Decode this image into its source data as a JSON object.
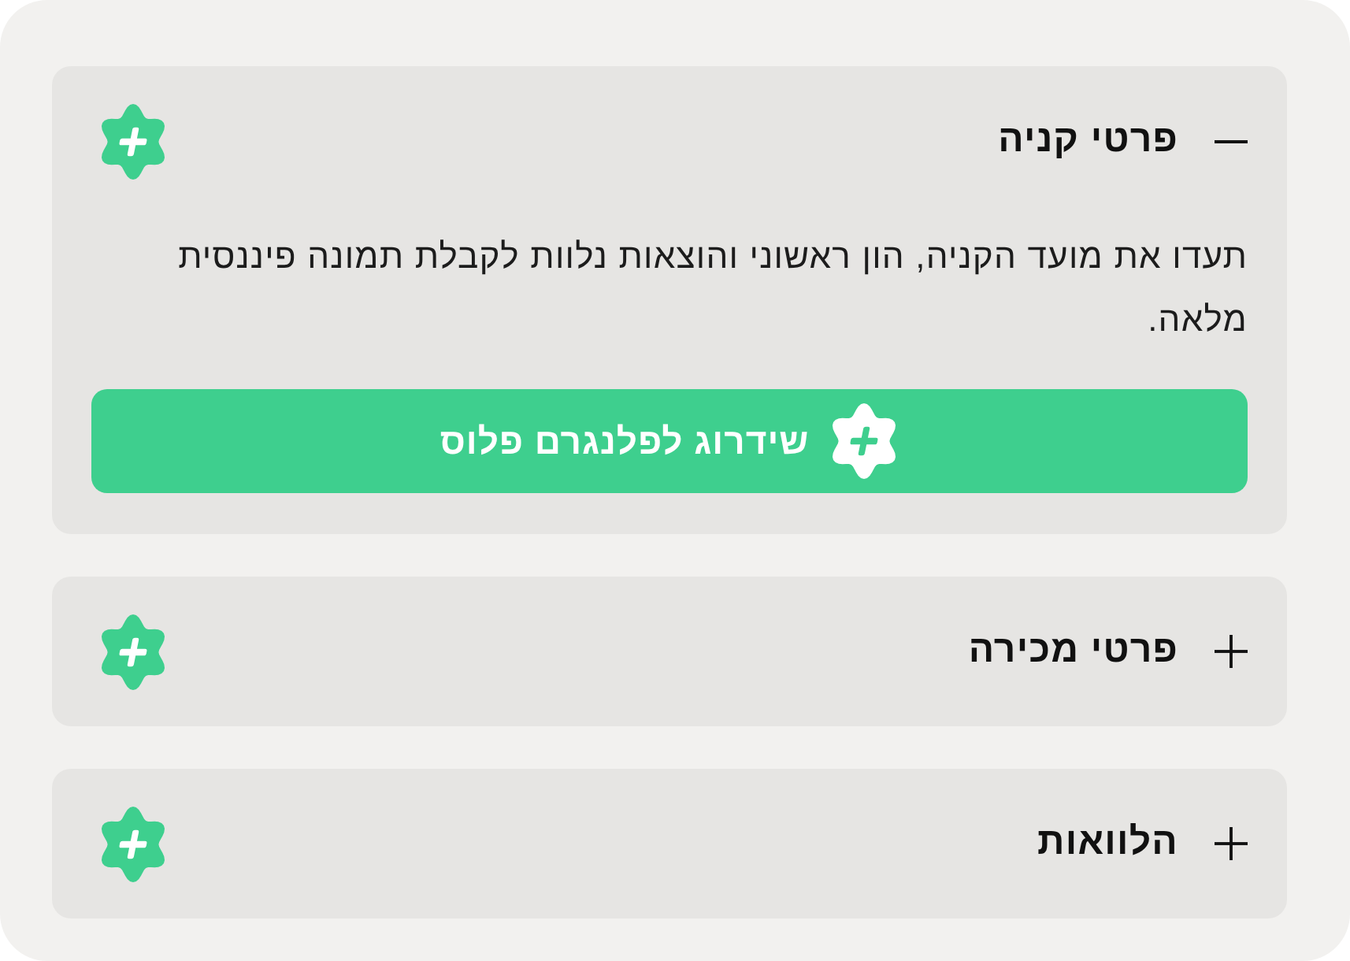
{
  "accordion": [
    {
      "title": "פרטי קניה",
      "expanded": true,
      "description": "תעדו את מועד הקניה, הון ראשוני והוצאות נלוות לקבלת תמונה פיננסית מלאה.",
      "button": "שידרוג לפלנגרם פלוס"
    },
    {
      "title": "פרטי מכירה",
      "expanded": false
    },
    {
      "title": "הלוואות",
      "expanded": false
    }
  ]
}
